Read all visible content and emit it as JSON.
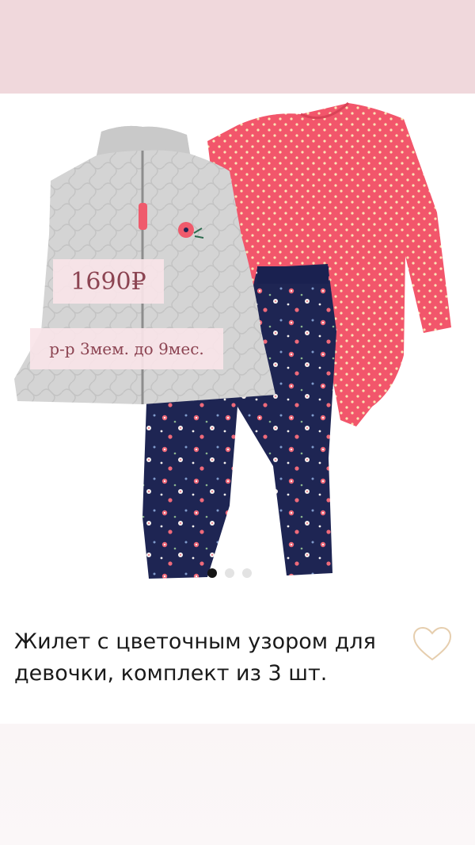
{
  "product": {
    "price_badge": "1690₽",
    "size_badge": "р-р 3мем. до 9мес.",
    "title": "Жилет с цветочным узором для девочки, комплект из 3 шт.",
    "image_alt": "vest-bodysuit-pants-set",
    "carousel": {
      "total": 3,
      "active": 1
    },
    "favorite_icon": "heart-outline-icon"
  },
  "colors": {
    "top_band": "#f0d8dc",
    "badge_text": "#8c4452",
    "heart": "#e6ceae",
    "vest": "#d3d3d3",
    "bodysuit": "#f2566b",
    "pants": "#1d2552"
  }
}
